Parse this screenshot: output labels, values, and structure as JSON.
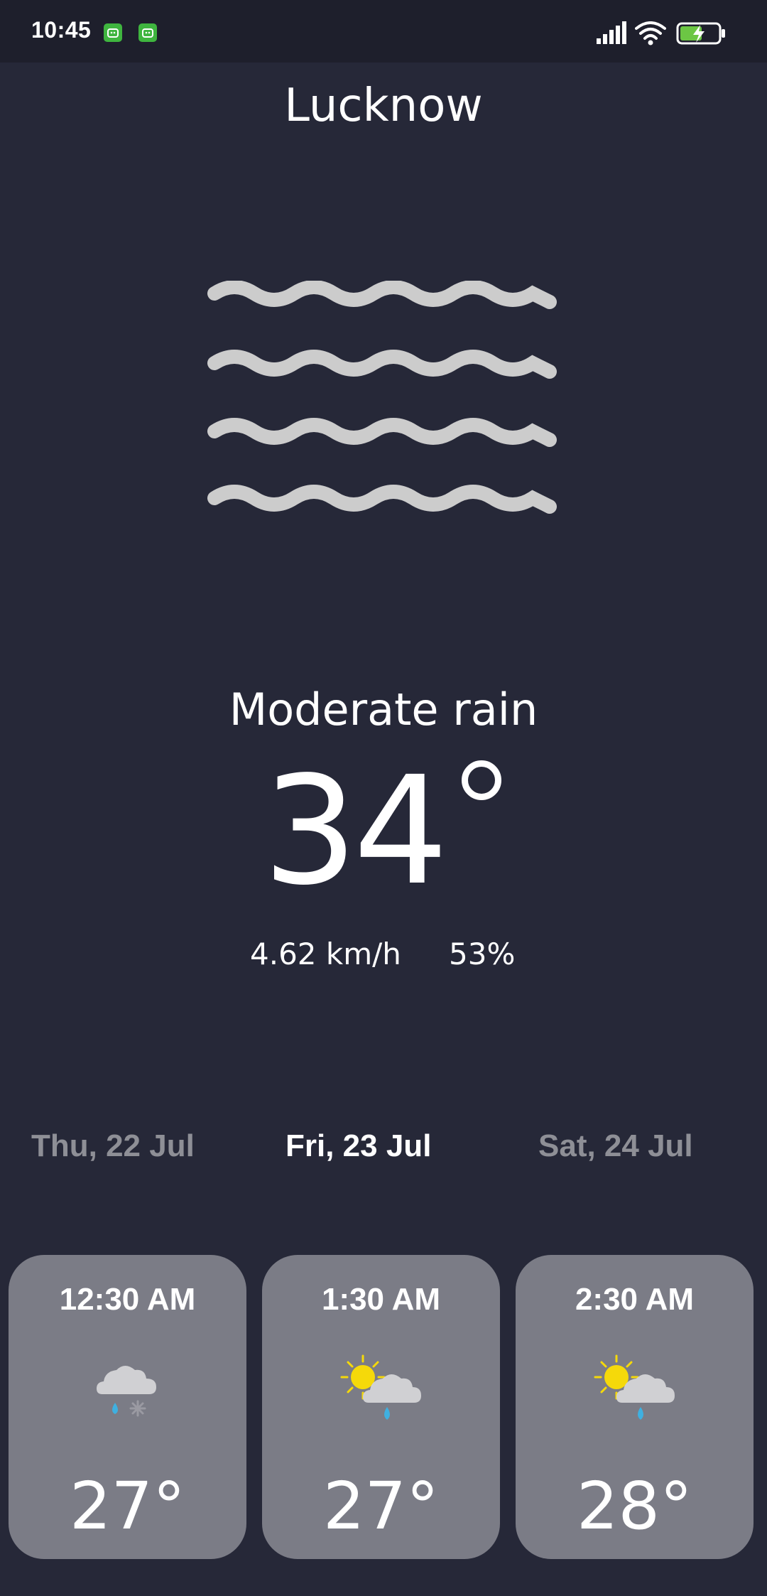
{
  "status_bar": {
    "time": "10:45",
    "notification_icons": [
      "app-notification-icon",
      "app-notification-icon"
    ],
    "system_icons": [
      "signal-icon",
      "wifi-icon",
      "battery-charging-icon"
    ]
  },
  "location": {
    "city": "Lucknow"
  },
  "current": {
    "icon": "mist-icon",
    "condition": "Moderate rain",
    "temperature": "34",
    "wind": "4.62 km/h",
    "humidity": "53%"
  },
  "days": [
    {
      "label": "Thu, 22 Jul",
      "selected": false
    },
    {
      "label": "Fri, 23 Jul",
      "selected": true
    },
    {
      "label": "Sat, 24 Jul",
      "selected": false
    }
  ],
  "hourly": [
    {
      "time": "12:30 AM",
      "icon": "sleet-icon",
      "temp": "27°"
    },
    {
      "time": "1:30 AM",
      "icon": "partly-cloudy-rain-icon",
      "temp": "27°"
    },
    {
      "time": "2:30 AM",
      "icon": "partly-cloudy-rain-icon",
      "temp": "28°"
    }
  ],
  "colors": {
    "background": "#262838",
    "status_bar": "#1e1f2c",
    "card": "#7b7c86",
    "inactive_tab": "#8e8f96",
    "icon_gray": "#cccccc",
    "sun": "#f5d90a",
    "rain_drop": "#3fb0e0",
    "battery_green": "#6cc644"
  }
}
